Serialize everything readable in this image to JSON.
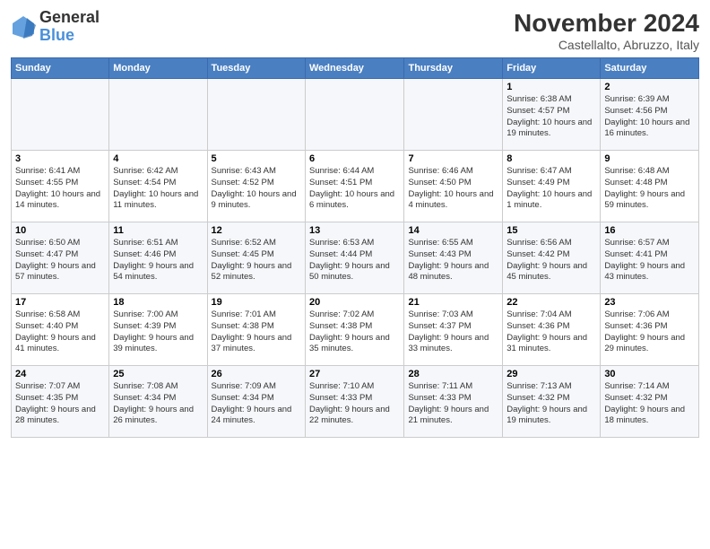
{
  "header": {
    "logo_line1": "General",
    "logo_line2": "Blue",
    "month": "November 2024",
    "location": "Castellalto, Abruzzo, Italy"
  },
  "weekdays": [
    "Sunday",
    "Monday",
    "Tuesday",
    "Wednesday",
    "Thursday",
    "Friday",
    "Saturday"
  ],
  "weeks": [
    [
      {
        "day": "",
        "info": ""
      },
      {
        "day": "",
        "info": ""
      },
      {
        "day": "",
        "info": ""
      },
      {
        "day": "",
        "info": ""
      },
      {
        "day": "",
        "info": ""
      },
      {
        "day": "1",
        "info": "Sunrise: 6:38 AM\nSunset: 4:57 PM\nDaylight: 10 hours and 19 minutes."
      },
      {
        "day": "2",
        "info": "Sunrise: 6:39 AM\nSunset: 4:56 PM\nDaylight: 10 hours and 16 minutes."
      }
    ],
    [
      {
        "day": "3",
        "info": "Sunrise: 6:41 AM\nSunset: 4:55 PM\nDaylight: 10 hours and 14 minutes."
      },
      {
        "day": "4",
        "info": "Sunrise: 6:42 AM\nSunset: 4:54 PM\nDaylight: 10 hours and 11 minutes."
      },
      {
        "day": "5",
        "info": "Sunrise: 6:43 AM\nSunset: 4:52 PM\nDaylight: 10 hours and 9 minutes."
      },
      {
        "day": "6",
        "info": "Sunrise: 6:44 AM\nSunset: 4:51 PM\nDaylight: 10 hours and 6 minutes."
      },
      {
        "day": "7",
        "info": "Sunrise: 6:46 AM\nSunset: 4:50 PM\nDaylight: 10 hours and 4 minutes."
      },
      {
        "day": "8",
        "info": "Sunrise: 6:47 AM\nSunset: 4:49 PM\nDaylight: 10 hours and 1 minute."
      },
      {
        "day": "9",
        "info": "Sunrise: 6:48 AM\nSunset: 4:48 PM\nDaylight: 9 hours and 59 minutes."
      }
    ],
    [
      {
        "day": "10",
        "info": "Sunrise: 6:50 AM\nSunset: 4:47 PM\nDaylight: 9 hours and 57 minutes."
      },
      {
        "day": "11",
        "info": "Sunrise: 6:51 AM\nSunset: 4:46 PM\nDaylight: 9 hours and 54 minutes."
      },
      {
        "day": "12",
        "info": "Sunrise: 6:52 AM\nSunset: 4:45 PM\nDaylight: 9 hours and 52 minutes."
      },
      {
        "day": "13",
        "info": "Sunrise: 6:53 AM\nSunset: 4:44 PM\nDaylight: 9 hours and 50 minutes."
      },
      {
        "day": "14",
        "info": "Sunrise: 6:55 AM\nSunset: 4:43 PM\nDaylight: 9 hours and 48 minutes."
      },
      {
        "day": "15",
        "info": "Sunrise: 6:56 AM\nSunset: 4:42 PM\nDaylight: 9 hours and 45 minutes."
      },
      {
        "day": "16",
        "info": "Sunrise: 6:57 AM\nSunset: 4:41 PM\nDaylight: 9 hours and 43 minutes."
      }
    ],
    [
      {
        "day": "17",
        "info": "Sunrise: 6:58 AM\nSunset: 4:40 PM\nDaylight: 9 hours and 41 minutes."
      },
      {
        "day": "18",
        "info": "Sunrise: 7:00 AM\nSunset: 4:39 PM\nDaylight: 9 hours and 39 minutes."
      },
      {
        "day": "19",
        "info": "Sunrise: 7:01 AM\nSunset: 4:38 PM\nDaylight: 9 hours and 37 minutes."
      },
      {
        "day": "20",
        "info": "Sunrise: 7:02 AM\nSunset: 4:38 PM\nDaylight: 9 hours and 35 minutes."
      },
      {
        "day": "21",
        "info": "Sunrise: 7:03 AM\nSunset: 4:37 PM\nDaylight: 9 hours and 33 minutes."
      },
      {
        "day": "22",
        "info": "Sunrise: 7:04 AM\nSunset: 4:36 PM\nDaylight: 9 hours and 31 minutes."
      },
      {
        "day": "23",
        "info": "Sunrise: 7:06 AM\nSunset: 4:36 PM\nDaylight: 9 hours and 29 minutes."
      }
    ],
    [
      {
        "day": "24",
        "info": "Sunrise: 7:07 AM\nSunset: 4:35 PM\nDaylight: 9 hours and 28 minutes."
      },
      {
        "day": "25",
        "info": "Sunrise: 7:08 AM\nSunset: 4:34 PM\nDaylight: 9 hours and 26 minutes."
      },
      {
        "day": "26",
        "info": "Sunrise: 7:09 AM\nSunset: 4:34 PM\nDaylight: 9 hours and 24 minutes."
      },
      {
        "day": "27",
        "info": "Sunrise: 7:10 AM\nSunset: 4:33 PM\nDaylight: 9 hours and 22 minutes."
      },
      {
        "day": "28",
        "info": "Sunrise: 7:11 AM\nSunset: 4:33 PM\nDaylight: 9 hours and 21 minutes."
      },
      {
        "day": "29",
        "info": "Sunrise: 7:13 AM\nSunset: 4:32 PM\nDaylight: 9 hours and 19 minutes."
      },
      {
        "day": "30",
        "info": "Sunrise: 7:14 AM\nSunset: 4:32 PM\nDaylight: 9 hours and 18 minutes."
      }
    ]
  ]
}
